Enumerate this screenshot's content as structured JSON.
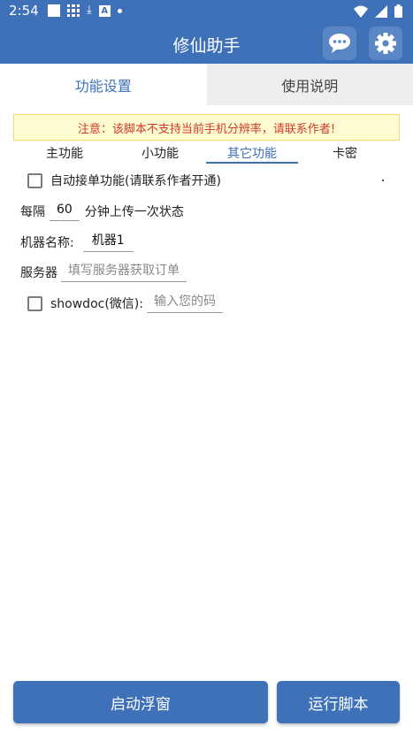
{
  "status_bar": {
    "time": "2:54",
    "download_glyph": "⤓",
    "a_glyph": "A",
    "icons_left": [
      "square-icon",
      "grid-icon",
      "download-icon",
      "a-box-icon",
      "dot-icon"
    ],
    "icons_right": [
      "wifi-icon",
      "signal-icon",
      "battery-icon"
    ]
  },
  "app_bar": {
    "title": "修仙助手",
    "icons": [
      "chat-icon",
      "gear-icon"
    ]
  },
  "tabs": [
    {
      "label": "功能设置",
      "active": true
    },
    {
      "label": "使用说明",
      "active": false
    }
  ],
  "notice": "注意：该脚本不支持当前手机分辨率，请联系作者!",
  "sub_tabs": [
    {
      "label": "主功能",
      "active": false
    },
    {
      "label": "小功能",
      "active": false
    },
    {
      "label": "其它功能",
      "active": true
    },
    {
      "label": "卡密",
      "active": false
    }
  ],
  "form": {
    "auto_order_label": "自动接单功能(请联系作者开通)",
    "auto_order_checked": false,
    "interval_prefix": "每隔",
    "interval_value": "60",
    "interval_suffix": "分钟上传一次状态",
    "machine_label": "机器名称:",
    "machine_value": "机器1",
    "server_label": "服务器",
    "server_placeholder": "填写服务器获取订单",
    "showdoc_label": "showdoc(微信):",
    "showdoc_checked": false,
    "showdoc_placeholder": "输入您的码"
  },
  "buttons": {
    "float_label": "启动浮窗",
    "run_label": "运行脚本"
  },
  "colors": {
    "primary": "#3f71b9",
    "notice_bg": "#fffbd0",
    "notice_text": "#d23a2a",
    "inactive_tab_bg": "#eeeeee"
  }
}
